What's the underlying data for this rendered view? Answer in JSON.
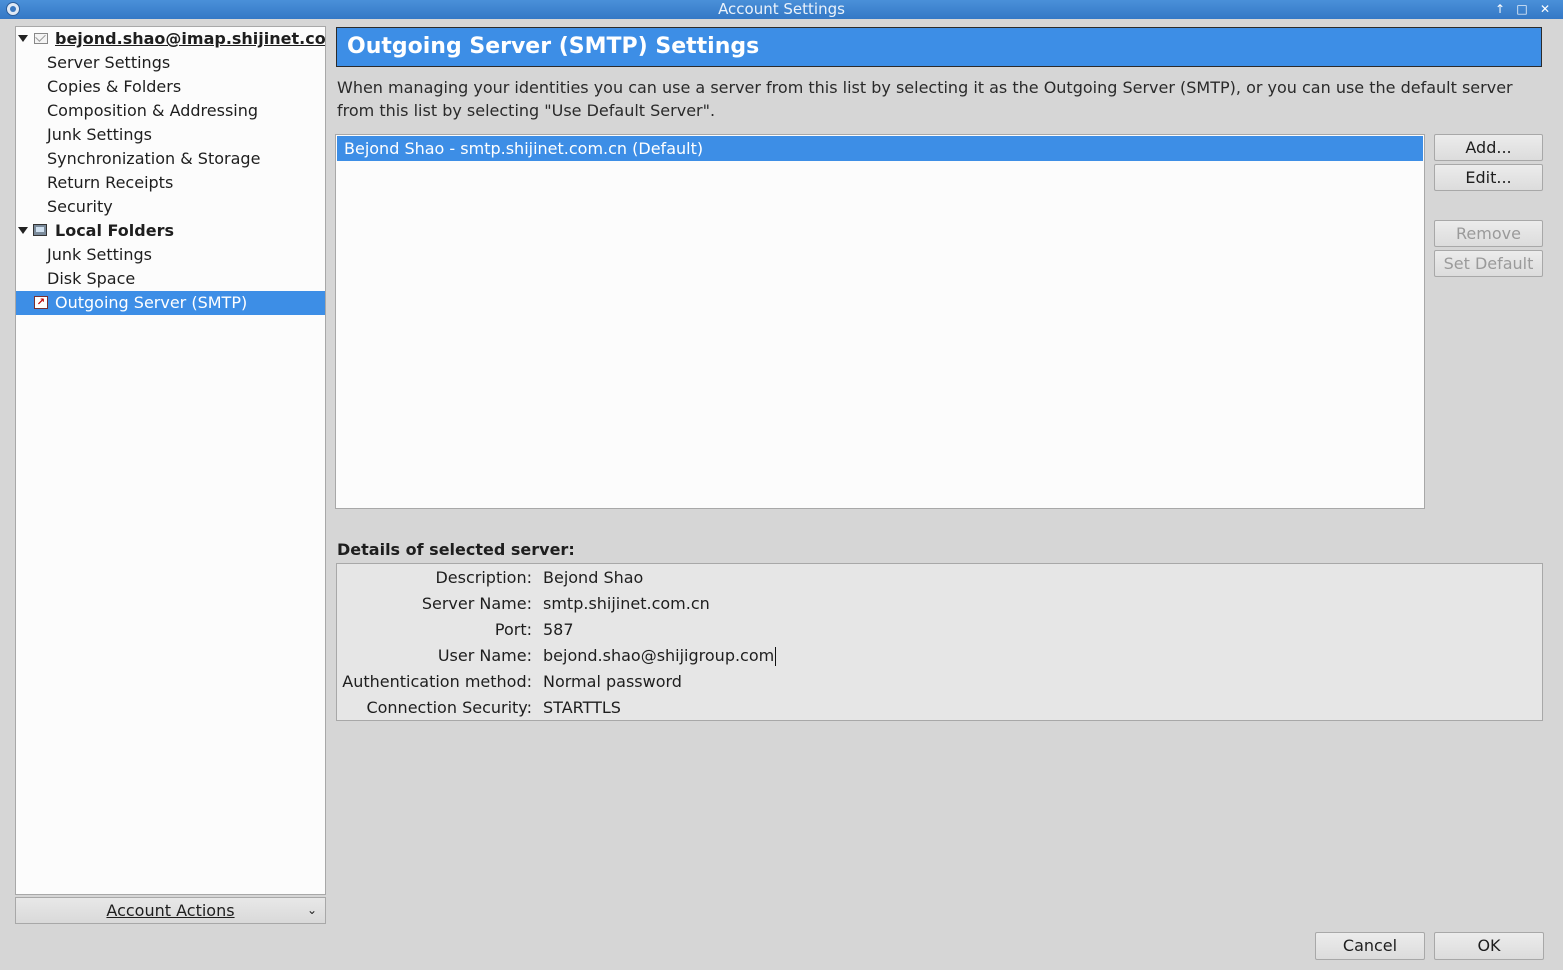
{
  "window": {
    "title": "Account Settings"
  },
  "tree": {
    "account": {
      "label": "bejond.shao@imap.shijinet.co..."
    },
    "account_items": [
      "Server Settings",
      "Copies & Folders",
      "Composition & Addressing",
      "Junk Settings",
      "Synchronization & Storage",
      "Return Receipts",
      "Security"
    ],
    "local": {
      "label": "Local Folders"
    },
    "local_items": [
      "Junk Settings",
      "Disk Space"
    ],
    "smtp": {
      "label": "Outgoing Server (SMTP)"
    }
  },
  "account_actions": {
    "label": "Account Actions"
  },
  "main": {
    "title": "Outgoing Server (SMTP) Settings",
    "description": "When managing your identities you can use a server from this list by selecting it as the Outgoing Server (SMTP), or you can use the default server from this list by selecting \"Use Default Server\".",
    "servers": [
      "Bejond Shao - smtp.shijinet.com.cn (Default)"
    ],
    "buttons": {
      "add": "Add...",
      "edit": "Edit...",
      "remove": "Remove",
      "set_default": "Set Default"
    },
    "details_title": "Details of selected server:",
    "details": {
      "description_label": "Description:",
      "description_value": "Bejond Shao",
      "server_name_label": "Server Name:",
      "server_name_value": "smtp.shijinet.com.cn",
      "port_label": "Port:",
      "port_value": "587",
      "user_name_label": "User Name:",
      "user_name_value": "bejond.shao@shijigroup.com",
      "auth_label": "Authentication method:",
      "auth_value": "Normal password",
      "security_label": "Connection Security:",
      "security_value": "STARTTLS"
    }
  },
  "dialog": {
    "cancel": "Cancel",
    "ok": "OK"
  },
  "colors": {
    "accent": "#3d8ee6",
    "titlebar": "#3478c6"
  }
}
